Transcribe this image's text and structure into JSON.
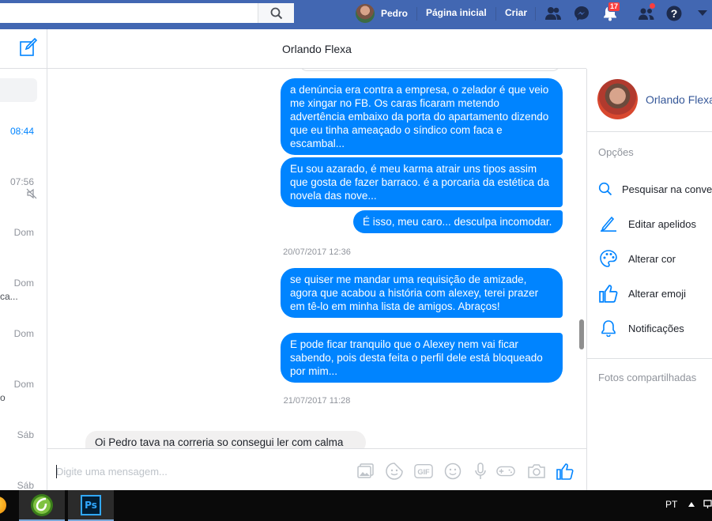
{
  "topbar": {
    "search_placeholder": "",
    "user_name": "Pedro",
    "home_label": "Página inicial",
    "create_label": "Criar",
    "notifications_count": "17"
  },
  "left": {
    "items": [
      {
        "time": "08:44",
        "snippet": ""
      },
      {
        "time": "07:56",
        "snippet": ""
      },
      {
        "time": "Dom",
        "snippet": ""
      },
      {
        "time": "Dom",
        "snippet": "ca..."
      },
      {
        "time": "Dom",
        "snippet": ""
      },
      {
        "time": "Dom",
        "snippet": "o"
      },
      {
        "time": "Sáb",
        "snippet": ""
      },
      {
        "time": "Sáb",
        "snippet": ""
      }
    ]
  },
  "conversation": {
    "title": "Orlando Flexa",
    "messages": [
      {
        "text": "a denúncia era contra a empresa, o zelador é que veio me xingar no FB. Os caras ficaram metendo advertência embaixo da porta do apartamento dizendo que eu tinha ameaçado o síndico com faca e escambal...",
        "direction": "out"
      },
      {
        "text": "Eu sou azarado, é meu karma atrair uns tipos assim que gosta de fazer barraco. é a porcaria da estética da novela das nove...",
        "direction": "out"
      },
      {
        "text": "É isso, meu caro... desculpa incomodar.",
        "direction": "out"
      },
      {
        "text": "se quiser me mandar uma requisição de amizade, agora que acabou a história com alexey, terei prazer em tê-lo em minha lista de amigos. Abraços!",
        "direction": "out"
      },
      {
        "text": "E pode ficar tranquilo que o Alexey nem vai ficar sabendo, pois desta feita o perfil dele está bloqueado por mim...",
        "direction": "out"
      },
      {
        "text": "Oi Pedro tava na correria so consegui ler com calma",
        "direction": "in"
      }
    ],
    "timestamps": [
      "20/07/2017 12:36",
      "21/07/2017 11:28"
    ]
  },
  "composer": {
    "placeholder": "Digite uma mensagem..."
  },
  "right": {
    "profile_name": "Orlando Flexa",
    "options_title": "Opções",
    "options": [
      {
        "label": "Pesquisar na conversa",
        "icon": "search-icon"
      },
      {
        "label": "Editar apelidos",
        "icon": "pencil-icon"
      },
      {
        "label": "Alterar cor",
        "icon": "palette-icon"
      },
      {
        "label": "Alterar emoji",
        "icon": "thumbs-up-icon"
      },
      {
        "label": "Notificações",
        "icon": "bell-icon"
      }
    ],
    "photos_title": "Fotos compartilhadas"
  },
  "taskbar": {
    "language": "PT",
    "apps": [
      "dreamweaver-icon",
      "photoshop-icon"
    ],
    "photoshop_label": "Ps"
  },
  "colors": {
    "facebook_blue": "#4267b2",
    "messenger_blue": "#0084ff"
  }
}
